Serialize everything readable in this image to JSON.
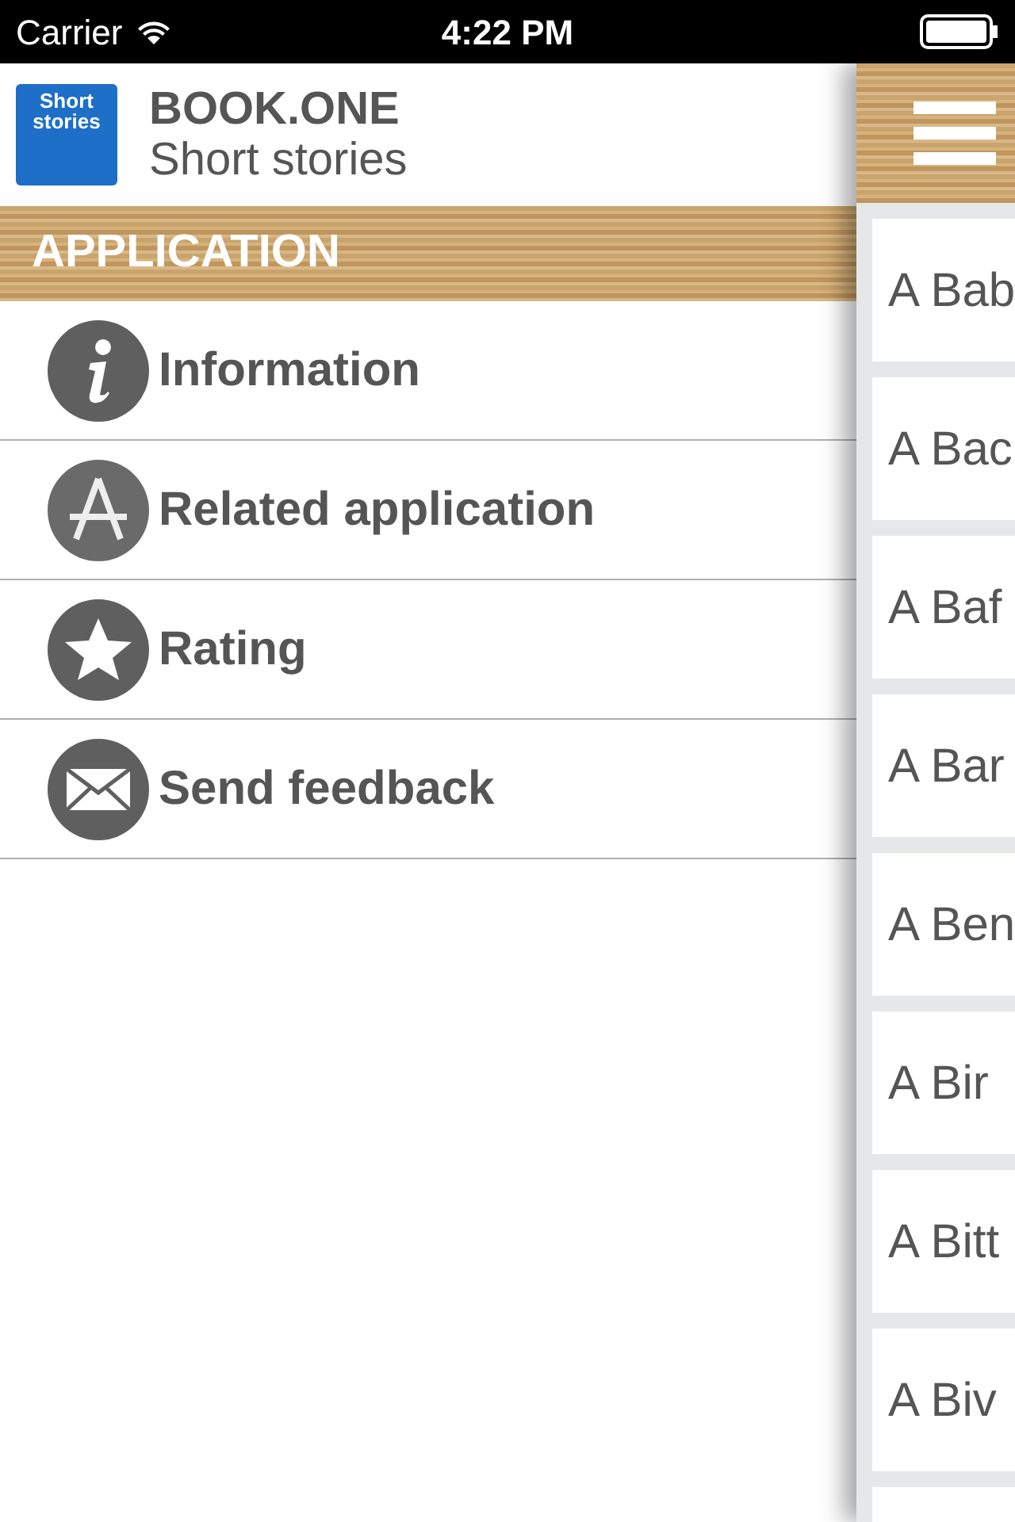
{
  "status_bar": {
    "carrier": "Carrier",
    "time": "4:22 PM"
  },
  "menu": {
    "logo_text": "Short stories",
    "title": "BOOK.ONE",
    "subtitle": "Short stories",
    "section": "APPLICATION",
    "items": [
      {
        "kind": "info",
        "label": "Information"
      },
      {
        "kind": "apps",
        "label": "Related application"
      },
      {
        "kind": "rating",
        "label": "Rating"
      },
      {
        "kind": "mail",
        "label": "Send feedback"
      }
    ]
  },
  "stories": [
    "A Bab",
    "A Bac",
    "A Baf",
    "A Bar",
    "A Ben",
    "A Bir",
    "A Bitt",
    "A Biv"
  ]
}
